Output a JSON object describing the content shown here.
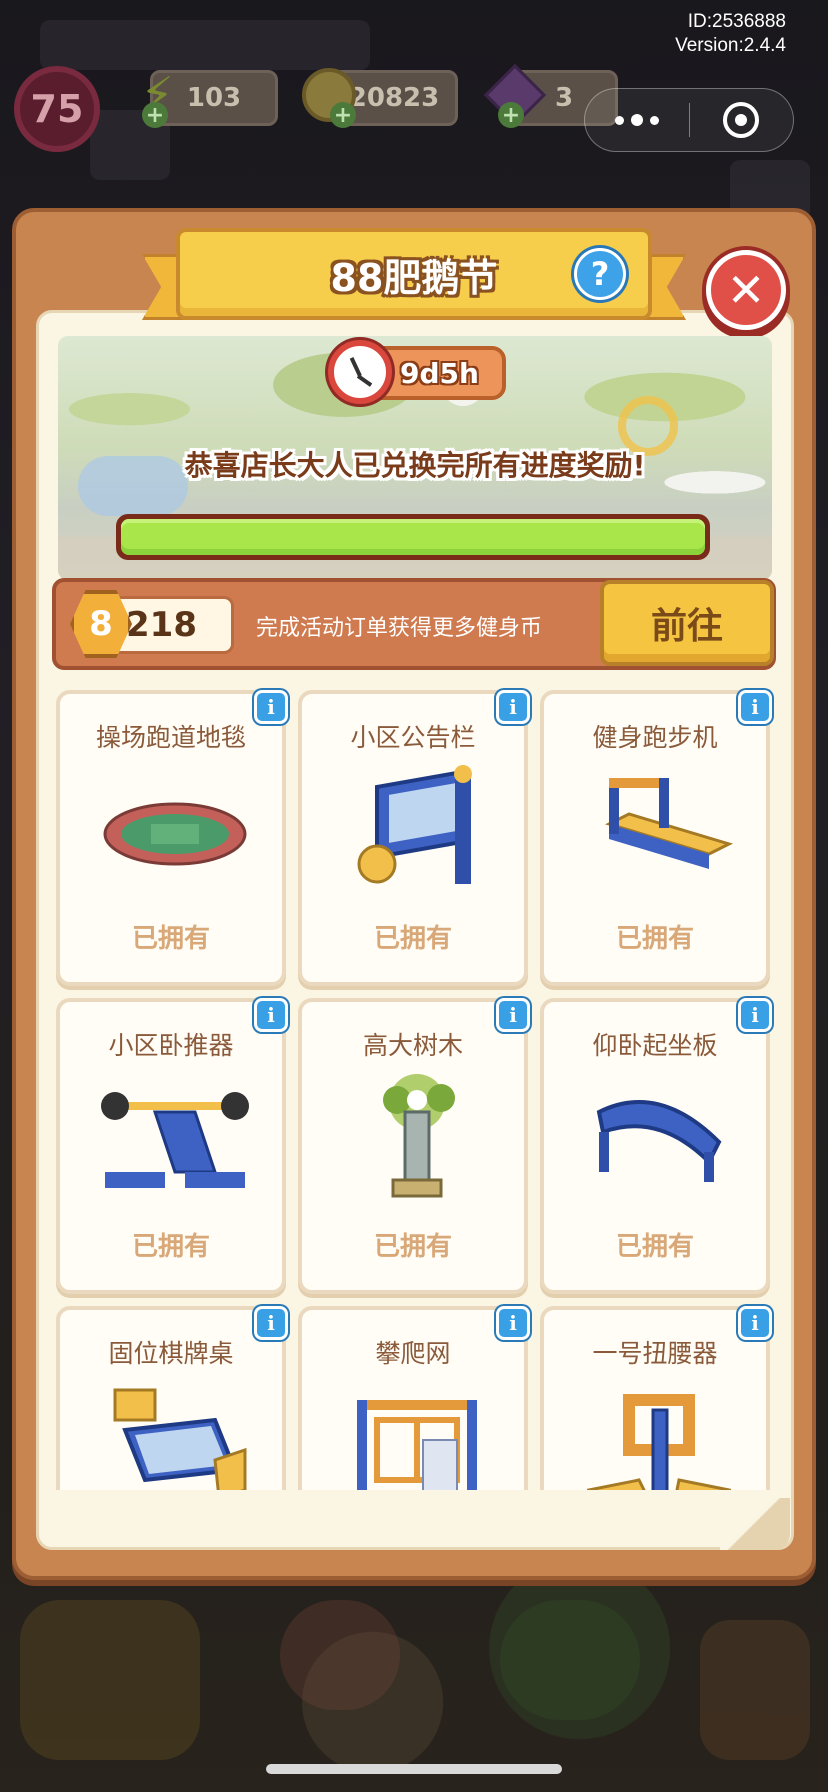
{
  "hud": {
    "id_text": "ID:2536888",
    "version_text": "Version:2.4.4",
    "level": "75",
    "energy": "103",
    "coins": "20823",
    "gems": "3"
  },
  "modal": {
    "title": "88肥鹅节",
    "timer": "9d5h",
    "congrats": "恭喜店长大人已兑换完所有进度奖励!",
    "progress": 1.0,
    "coin_icon_label": "8",
    "coin_count": "218",
    "coin_hint": "完成活动订单获得更多健身币",
    "go_label": "前往"
  },
  "items": [
    {
      "name": "操场跑道地毯",
      "status": "已拥有",
      "art": "running-track"
    },
    {
      "name": "小区公告栏",
      "status": "已拥有",
      "art": "bulletin-board"
    },
    {
      "name": "健身跑步机",
      "status": "已拥有",
      "art": "treadmill"
    },
    {
      "name": "小区卧推器",
      "status": "已拥有",
      "art": "bench-press"
    },
    {
      "name": "高大树木",
      "status": "已拥有",
      "art": "tall-tree"
    },
    {
      "name": "仰卧起坐板",
      "status": "已拥有",
      "art": "situp-board"
    },
    {
      "name": "固位棋牌桌",
      "status": "",
      "art": "chess-table"
    },
    {
      "name": "攀爬网",
      "status": "",
      "art": "climbing-net"
    },
    {
      "name": "一号扭腰器",
      "status": "",
      "art": "waist-twister"
    }
  ],
  "colors": {
    "frame": "#c8854f",
    "paper": "#fbf5e4",
    "progress": "#a8e64a",
    "info": "#3aa0e6",
    "close": "#e05048"
  }
}
